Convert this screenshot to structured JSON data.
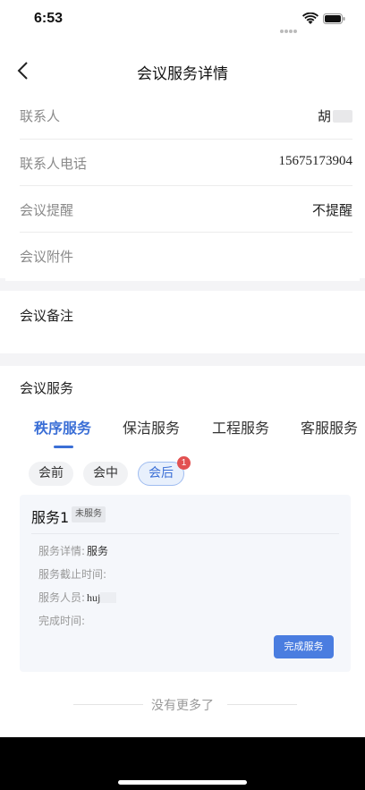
{
  "status_bar": {
    "time": "6:53"
  },
  "nav": {
    "title": "会议服务详情"
  },
  "info": {
    "rows": [
      {
        "label": "联系人",
        "value": "胡"
      },
      {
        "label": "联系人电话",
        "value": "15675173904"
      },
      {
        "label": "会议提醒",
        "value": "不提醒"
      },
      {
        "label": "会议附件",
        "value": ""
      }
    ]
  },
  "notes": {
    "title": "会议备注"
  },
  "services": {
    "title": "会议服务",
    "tabs": [
      "秩序服务",
      "保洁服务",
      "工程服务",
      "客服服务"
    ],
    "phases": [
      "会前",
      "会中",
      "会后"
    ],
    "badge_count": "1",
    "card": {
      "title": "服务1",
      "status": "未服务",
      "detail_label": "服务详情:",
      "detail_value": "服务",
      "deadline_label": "服务截止时间:",
      "staff_label": "服务人员:",
      "staff_value": "huj",
      "done_label": "完成时间:",
      "button": "完成服务"
    },
    "end_text": "没有更多了"
  },
  "colors": {
    "accent": "#3b6fd6",
    "badge": "#e25151",
    "button": "#4a7de0"
  }
}
